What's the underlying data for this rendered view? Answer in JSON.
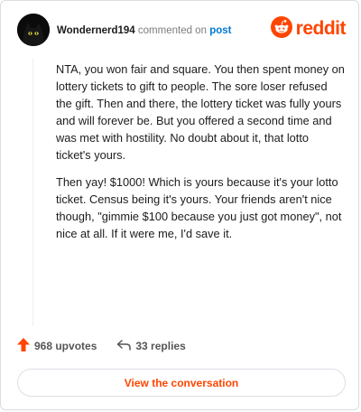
{
  "header": {
    "username": "Wondernerd194",
    "action_text": "commented on",
    "post_link": "post",
    "brand": "reddit",
    "avatar_icon": "black-cat-avatar-icon",
    "logo_icon": "reddit-alien-icon"
  },
  "comment": {
    "paragraphs": [
      "NTA, you won fair and square. You then spent money on lottery tickets to gift to people. The sore loser refused the gift. Then and there, the lottery ticket was fully yours and will forever be. But you offered a second time and was met with hostility. No doubt about it, that lotto ticket's yours.",
      "Then yay! $1000! Which is yours because it's your lotto ticket. Census being it's yours. Your friends aren't nice though, \"gimmie $100 because you just got money\", not nice at all. If it were me, I'd save it."
    ]
  },
  "stats": {
    "upvotes": "968 upvotes",
    "replies": "33 replies",
    "upvote_icon": "upvote-arrow-icon",
    "reply_icon": "reply-arrow-icon"
  },
  "cta": {
    "label": "View the conversation"
  },
  "colors": {
    "brand": "#ff4500",
    "link": "#0079d3",
    "text": "#1c1c1c",
    "muted": "#7c7c7c"
  }
}
